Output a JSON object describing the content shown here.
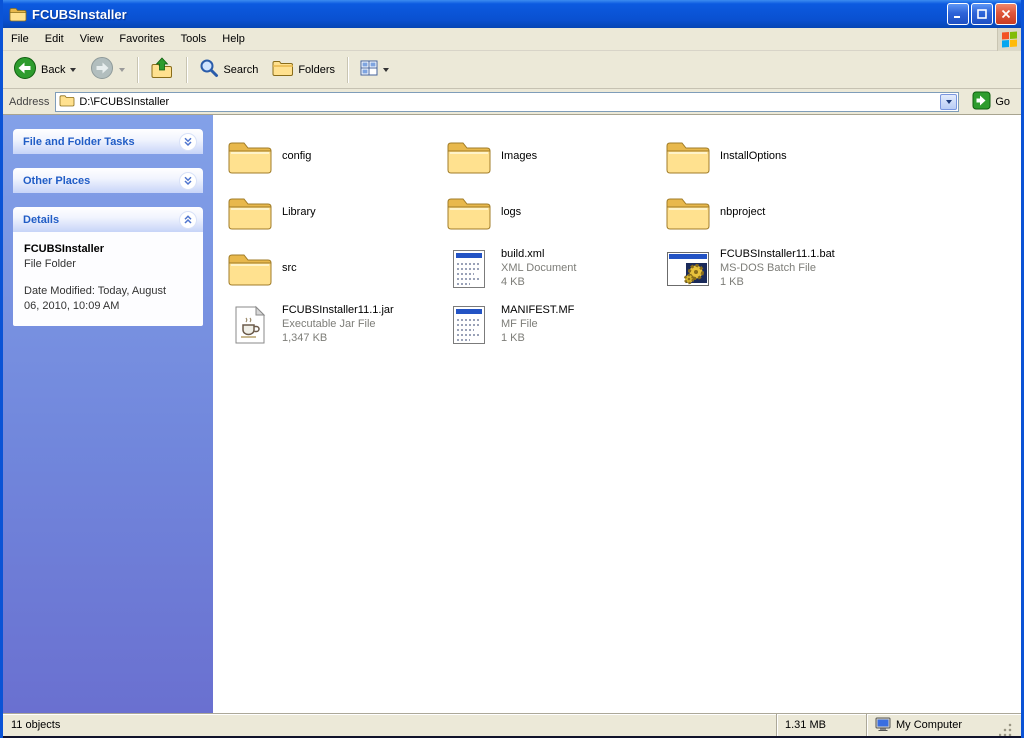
{
  "window": {
    "title": "FCUBSInstaller"
  },
  "menu_bar": {
    "items": [
      "File",
      "Edit",
      "View",
      "Favorites",
      "Tools",
      "Help"
    ]
  },
  "toolbar": {
    "back": "Back",
    "search": "Search",
    "folders": "Folders"
  },
  "address_bar": {
    "label": "Address",
    "value": "D:\\FCUBSInstaller",
    "go": "Go"
  },
  "sidebar": {
    "tasks_panel_title": "File and Folder Tasks",
    "places_panel_title": "Other Places",
    "details_panel_title": "Details",
    "details": {
      "name": "FCUBSInstaller",
      "type": "File Folder",
      "modified": "Date Modified: Today, August 06, 2010, 10:09 AM"
    }
  },
  "files": [
    {
      "name": "config",
      "icon": "folder"
    },
    {
      "name": "Images",
      "icon": "folder"
    },
    {
      "name": "InstallOptions",
      "icon": "folder"
    },
    {
      "name": "Library",
      "icon": "folder"
    },
    {
      "name": "logs",
      "icon": "folder"
    },
    {
      "name": "nbproject",
      "icon": "folder"
    },
    {
      "name": "src",
      "icon": "folder"
    },
    {
      "name": "build.xml",
      "icon": "document",
      "type": "XML Document",
      "size": "4 KB"
    },
    {
      "name": "FCUBSInstaller11.1.bat",
      "icon": "gear-window",
      "type": "MS-DOS Batch File",
      "size": "1 KB"
    },
    {
      "name": "FCUBSInstaller11.1.jar",
      "icon": "java-archive",
      "type": "Executable Jar File",
      "size": "1,347 KB"
    },
    {
      "name": "MANIFEST.MF",
      "icon": "document",
      "type": "MF File",
      "size": "1 KB"
    }
  ],
  "status_bar": {
    "objects": "11 objects",
    "size": "1.31 MB",
    "location": "My Computer"
  }
}
